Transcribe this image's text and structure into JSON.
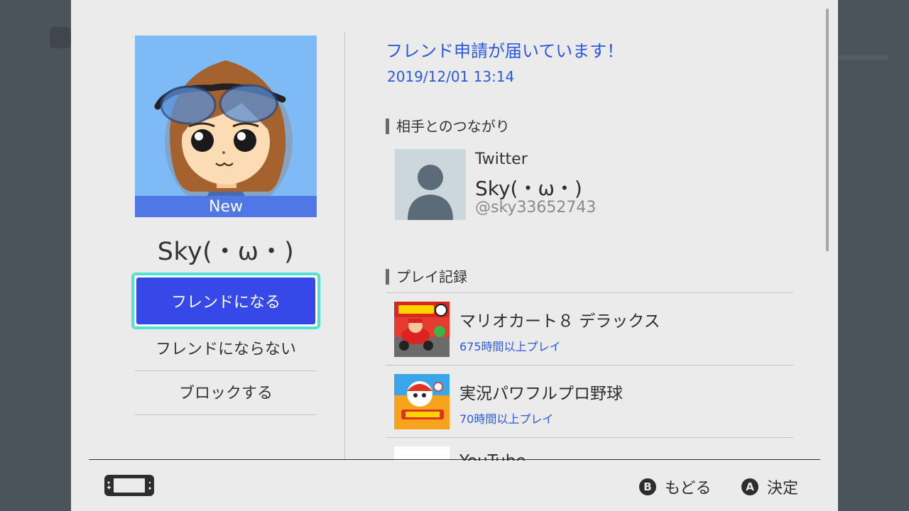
{
  "profile": {
    "name": "Sky(・ω・)",
    "badge": "New"
  },
  "actions": {
    "become_friend": "フレンドになる",
    "decline": "フレンドにならない",
    "block": "ブロックする"
  },
  "request": {
    "title": "フレンド申請が届いています！",
    "timestamp": "2019/12/01 13:14"
  },
  "connection": {
    "heading": "相手とのつながり",
    "service": "Twitter",
    "display_name": "Sky(・ω・)",
    "handle": "@sky33652743"
  },
  "play_record": {
    "heading": "プレイ記録",
    "games": [
      {
        "title": "マリオカート８ デラックス",
        "hours": "675時間以上プレイ"
      },
      {
        "title": "実況パワフルプロ野球",
        "hours": "70時間以上プレイ"
      },
      {
        "title": "YouTube",
        "hours": ""
      }
    ]
  },
  "footer": {
    "back_button": "B",
    "back_label": "もどる",
    "confirm_button": "A",
    "confirm_label": "決定"
  },
  "colors": {
    "accent_blue": "#3649e8",
    "link_blue": "#2b58e2",
    "focus_cyan": "#52e2d1"
  }
}
